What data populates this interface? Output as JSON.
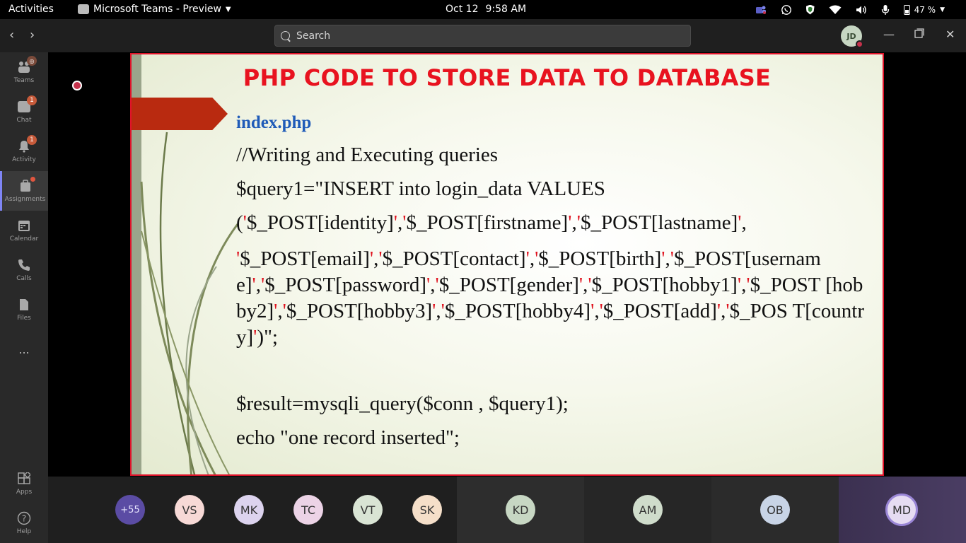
{
  "topbar": {
    "activities": "Activities",
    "app_name": "Microsoft Teams - Preview",
    "date": "Oct 12",
    "time": "9:58 AM",
    "battery": "47 %"
  },
  "titlebar": {
    "search_placeholder": "Search",
    "user_initials": "JD"
  },
  "rail": {
    "items": [
      {
        "label": "Teams"
      },
      {
        "label": "Chat",
        "badge": "1"
      },
      {
        "label": "Activity",
        "badge": "1"
      },
      {
        "label": "Assignments"
      },
      {
        "label": "Calendar"
      },
      {
        "label": "Calls"
      },
      {
        "label": "Files"
      },
      {
        "label": "Apps"
      },
      {
        "label": "Help"
      }
    ],
    "more": "..."
  },
  "slide": {
    "title": "PHP CODE TO STORE DATA TO DATABASE",
    "filename": "index.php",
    "comment": "//Writing and Executing queries",
    "query_line": "$query1=\"INSERT into login_data VALUES",
    "result_line": "$result=mysqli_query($conn , $query1);",
    "echo_line": "echo \"one record inserted\";"
  },
  "participants": [
    {
      "initials": "+55",
      "color": "#5b4ca4"
    },
    {
      "initials": "VS",
      "color": "#f7d9d6"
    },
    {
      "initials": "MK",
      "color": "#dcd3ee"
    },
    {
      "initials": "TC",
      "color": "#ecd3e6"
    },
    {
      "initials": "VT",
      "color": "#d9e4d4"
    },
    {
      "initials": "SK",
      "color": "#f5dfc9"
    },
    {
      "initials": "KD",
      "color": "#c7d7c3"
    },
    {
      "initials": "AM",
      "color": "#cfdccb"
    },
    {
      "initials": "OB",
      "color": "#c8d4e6"
    },
    {
      "initials": "MD",
      "color": "#e6dcf2"
    }
  ]
}
